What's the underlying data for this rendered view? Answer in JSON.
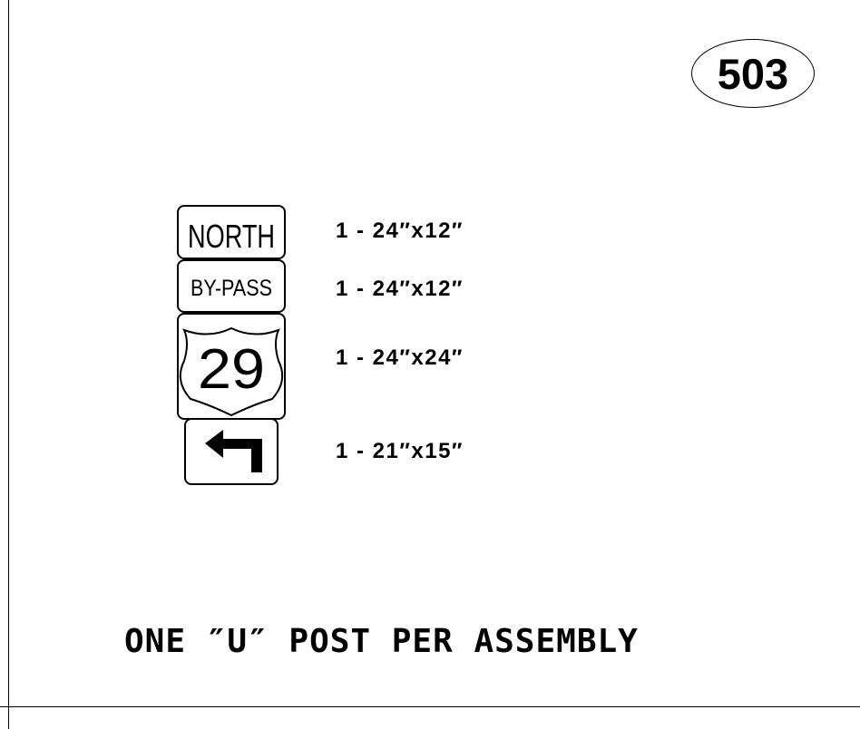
{
  "assembly_number": "503",
  "signs": [
    {
      "legend": "NORTH",
      "size": "1 - 24″x12″"
    },
    {
      "legend": "BY-PASS",
      "size": "1 - 24″x12″"
    },
    {
      "legend": "29",
      "size": "1 - 24″x24″"
    },
    {
      "legend": "left-turn-arrow",
      "size": "1 - 21″x15″"
    }
  ],
  "note": "ONE ″U″ POST PER ASSEMBLY"
}
